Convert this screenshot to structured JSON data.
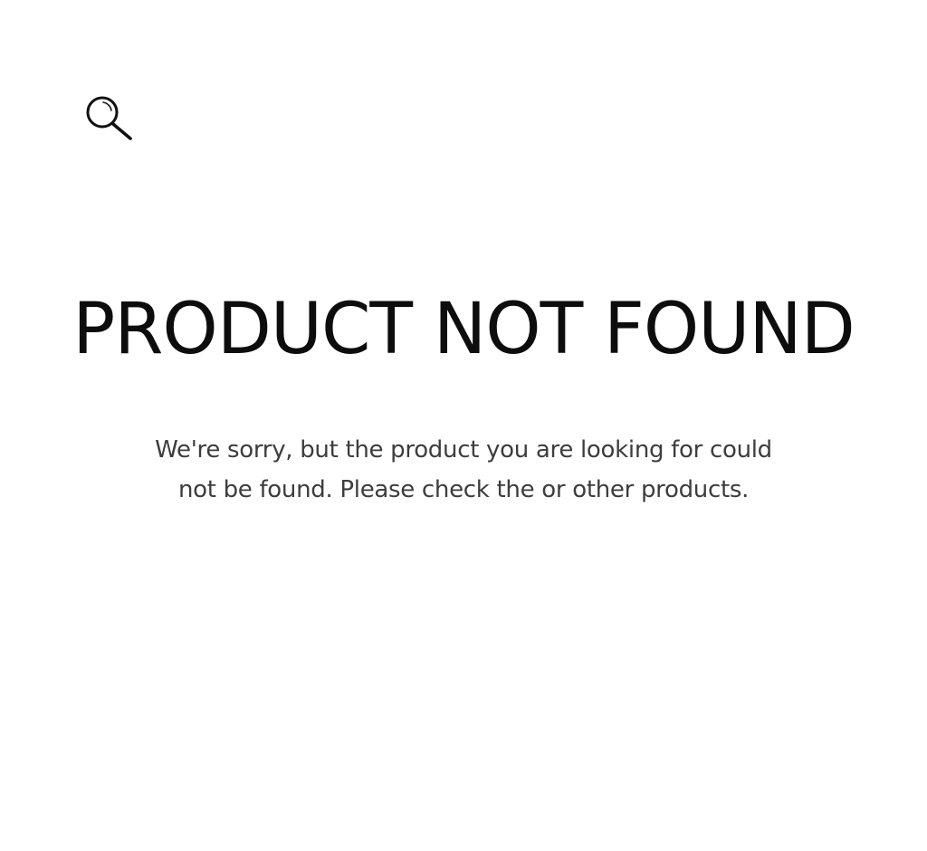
{
  "header": {
    "search_icon": "search-icon"
  },
  "main": {
    "title": "PRODUCT NOT FOUND",
    "message": "We're sorry, but the product you are looking for could not be found. Please check the or other products."
  },
  "colors": {
    "background": "#ffffff",
    "title": "#0d0d0d",
    "message": "#3d3d3d"
  }
}
